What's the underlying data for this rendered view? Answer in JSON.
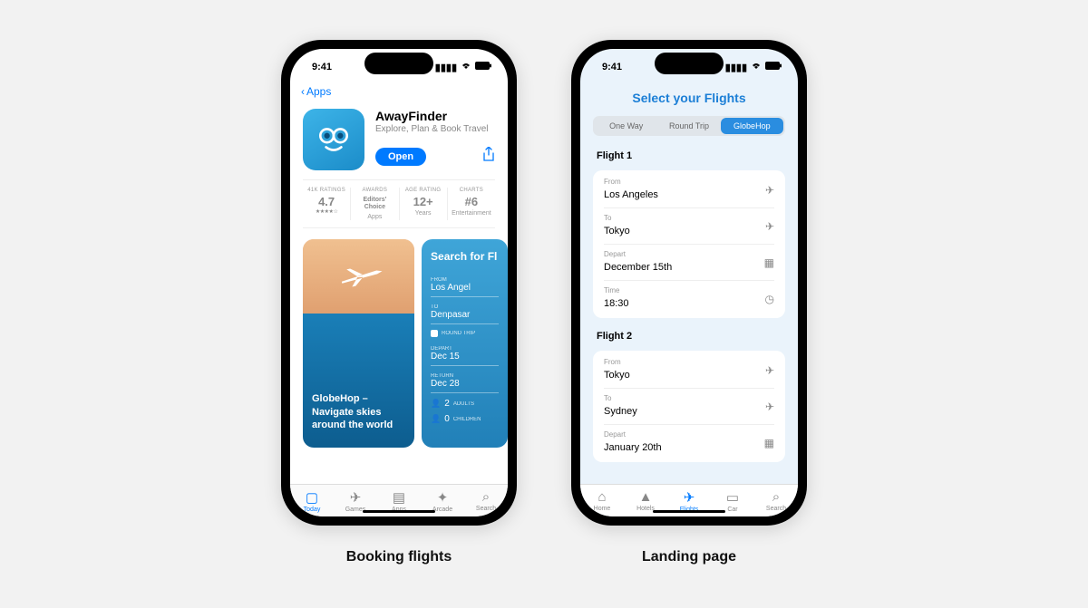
{
  "status": {
    "time": "9:41",
    "signal": "▪▪▪▪",
    "wifi": "◉",
    "battery": "▮"
  },
  "phone1": {
    "back_label": "Apps",
    "app": {
      "name": "AwayFinder",
      "subtitle": "Explore, Plan & Book Travel",
      "open": "Open"
    },
    "stats": {
      "ratings_label": "41K RATINGS",
      "ratings_val": "4.7",
      "stars": "★★★★☆",
      "awards_label": "AWARDS",
      "awards_val": "Editors' Choice",
      "awards_sub": "Apps",
      "age_label": "AGE RATING",
      "age_val": "12+",
      "age_sub": "Years",
      "charts_label": "CHARTS",
      "charts_val": "#6",
      "charts_sub": "Entertainment"
    },
    "promo1_text": "GlobeHop – Navigate skies around the world",
    "promo2": {
      "title": "Search for Fl",
      "from_label": "FROM",
      "from_val": "Los Angel",
      "to_label": "TO",
      "to_val": "Denpasar",
      "round_trip": "ROUND TRIP",
      "depart_label": "DEPART",
      "depart_val": "Dec 15",
      "return_label": "RETURN",
      "return_val": "Dec 28",
      "adults_n": "2",
      "adults": "ADULTS",
      "children_n": "0",
      "children": "CHILDREN"
    },
    "tabs": [
      "Today",
      "Games",
      "Apps",
      "Arcade",
      "Search"
    ]
  },
  "phone2": {
    "title": "Select your Flights",
    "segments": [
      "One Way",
      "Round Trip",
      "GlobeHop"
    ],
    "flight1": {
      "label": "Flight 1",
      "from_l": "From",
      "from_v": "Los Angeles",
      "to_l": "To",
      "to_v": "Tokyo",
      "depart_l": "Depart",
      "depart_v": "December 15th",
      "time_l": "Time",
      "time_v": "18:30"
    },
    "flight2": {
      "label": "Flight 2",
      "from_l": "From",
      "from_v": "Tokyo",
      "to_l": "To",
      "to_v": "Sydney",
      "depart_l": "Depart",
      "depart_v": "January 20th"
    },
    "tabs": [
      "Home",
      "Hotels",
      "Flights",
      "Car",
      "Search"
    ]
  },
  "captions": {
    "left": "Booking flights",
    "right": "Landing page"
  }
}
